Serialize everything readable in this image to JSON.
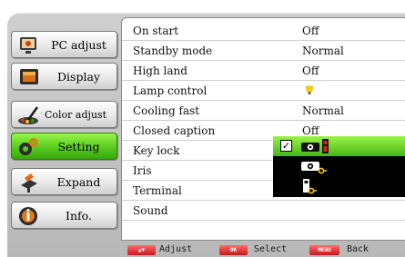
{
  "sidebar": {
    "items": [
      {
        "label": "PC adjust",
        "icon": "pc-adjust-icon",
        "active": false
      },
      {
        "label": "Display",
        "icon": "display-icon",
        "active": false
      },
      {
        "label": "Color adjust",
        "icon": "color-adjust-icon",
        "active": false
      },
      {
        "label": "Setting",
        "icon": "setting-icon",
        "active": true
      },
      {
        "label": "Expand",
        "icon": "expand-icon",
        "active": false
      },
      {
        "label": "Info.",
        "icon": "info-icon",
        "active": false
      }
    ]
  },
  "settings": {
    "rows": [
      {
        "label": "On start",
        "value": "Off"
      },
      {
        "label": "Standby mode",
        "value": "Normal"
      },
      {
        "label": "High land",
        "value": "Off"
      },
      {
        "label": "Lamp control",
        "value": "",
        "icon": "lamp-icon"
      },
      {
        "label": "Cooling fast",
        "value": "Normal"
      },
      {
        "label": "Closed caption",
        "value": "Off"
      },
      {
        "label": "Key lock",
        "value": ""
      },
      {
        "label": "Iris",
        "value": ""
      },
      {
        "label": "Terminal",
        "value": ""
      },
      {
        "label": "Sound",
        "value": ""
      }
    ]
  },
  "key_lock_dropdown": {
    "options": [
      {
        "icon": "projector-and-remote-lock-icon",
        "selected": true
      },
      {
        "icon": "projector-lock-icon",
        "selected": false
      },
      {
        "icon": "remote-lock-icon",
        "selected": false
      }
    ],
    "check_mark": "✓"
  },
  "footer": {
    "adjust_label": "Adjust",
    "select_label": "Select",
    "back_label": "Back",
    "adjust_key": "▲▼",
    "select_key": "OK",
    "back_key": "MENU"
  },
  "colors": {
    "active_tab": "#58cc1e",
    "dropdown_bg": "#000000",
    "key_button": "#c41a1a"
  }
}
